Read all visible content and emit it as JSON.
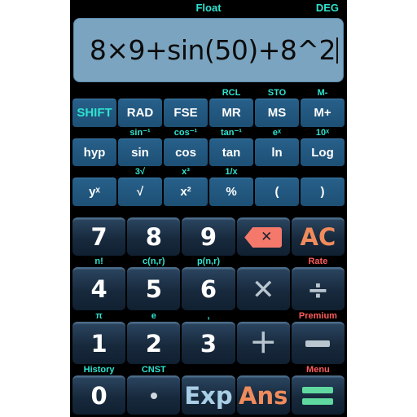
{
  "status": {
    "mode": "Float",
    "angle": "DEG"
  },
  "display": {
    "expression": "8×9+sin(50)+8^2"
  },
  "colors": {
    "cyan": "#2fe3d0",
    "red": "#ff5b5b",
    "orange": "#f08b5c",
    "green": "#5fd9a0",
    "display_bg": "#7ba4c0",
    "fn_button": "#20567e",
    "num_button": "#17293c"
  },
  "keypad": {
    "rows": [
      {
        "name": "row-shift",
        "keys": [
          {
            "sub": "",
            "label": "SHIFT",
            "icon": "",
            "style": "fn-cyan",
            "name": "shift"
          },
          {
            "sub": "",
            "label": "RAD",
            "icon": "",
            "style": "fn",
            "name": "rad"
          },
          {
            "sub": "",
            "label": "FSE",
            "icon": "",
            "style": "fn",
            "name": "fse"
          },
          {
            "sub": "RCL",
            "label": "MR",
            "icon": "",
            "style": "fn",
            "name": "memory-recall"
          },
          {
            "sub": "STO",
            "label": "MS",
            "icon": "",
            "style": "fn",
            "name": "memory-store"
          },
          {
            "sub": "M-",
            "label": "M+",
            "icon": "",
            "style": "fn",
            "name": "memory-add"
          }
        ]
      },
      {
        "name": "row-trig",
        "keys": [
          {
            "sub": "",
            "label": "hyp",
            "icon": "",
            "style": "fn",
            "name": "hyp"
          },
          {
            "sub": "sin⁻¹",
            "label": "sin",
            "icon": "",
            "style": "fn",
            "name": "sin"
          },
          {
            "sub": "cos⁻¹",
            "label": "cos",
            "icon": "",
            "style": "fn",
            "name": "cos"
          },
          {
            "sub": "tan⁻¹",
            "label": "tan",
            "icon": "",
            "style": "fn",
            "name": "tan"
          },
          {
            "sub": "eˣ",
            "label": "ln",
            "icon": "",
            "style": "fn",
            "name": "ln"
          },
          {
            "sub": "10ˣ",
            "label": "Log",
            "icon": "",
            "style": "fn",
            "name": "log"
          }
        ]
      },
      {
        "name": "row-power",
        "keys": [
          {
            "sub": "",
            "label": "yˣ",
            "icon": "",
            "style": "fn",
            "name": "y-to-x"
          },
          {
            "sub": "3√",
            "label": "√",
            "icon": "",
            "style": "fn",
            "name": "square-root"
          },
          {
            "sub": "x³",
            "label": "x²",
            "icon": "",
            "style": "fn",
            "name": "x-squared"
          },
          {
            "sub": "1/x",
            "label": "%",
            "icon": "",
            "style": "fn",
            "name": "percent"
          },
          {
            "sub": "",
            "label": "(",
            "icon": "",
            "style": "fn",
            "name": "open-paren"
          },
          {
            "sub": "",
            "label": ")",
            "icon": "",
            "style": "fn",
            "name": "close-paren"
          }
        ]
      },
      {
        "name": "row-789",
        "keys": [
          {
            "sub": "",
            "label": "7",
            "icon": "",
            "style": "num",
            "name": "digit-7"
          },
          {
            "sub": "",
            "label": "8",
            "icon": "",
            "style": "num",
            "name": "digit-8"
          },
          {
            "sub": "",
            "label": "9",
            "icon": "",
            "style": "num",
            "name": "digit-9"
          },
          {
            "sub": "",
            "label": "",
            "icon": "backspace",
            "style": "num",
            "name": "backspace"
          },
          {
            "sub": "",
            "label": "AC",
            "icon": "",
            "style": "num-orange",
            "name": "all-clear"
          }
        ]
      },
      {
        "name": "row-456",
        "keys": [
          {
            "sub": "n!",
            "label": "4",
            "icon": "",
            "style": "num",
            "name": "digit-4"
          },
          {
            "sub": "c(n,r)",
            "label": "5",
            "icon": "",
            "style": "num",
            "name": "digit-5"
          },
          {
            "sub": "p(n,r)",
            "label": "6",
            "icon": "",
            "style": "num",
            "name": "digit-6"
          },
          {
            "sub": "",
            "label": "",
            "icon": "multiply",
            "style": "num-op",
            "name": "multiply"
          },
          {
            "sub": "Rate",
            "subred": true,
            "label": "",
            "icon": "divide",
            "style": "num-op",
            "name": "divide"
          }
        ]
      },
      {
        "name": "row-123",
        "keys": [
          {
            "sub": "π",
            "label": "1",
            "icon": "",
            "style": "num",
            "name": "digit-1"
          },
          {
            "sub": "e",
            "label": "2",
            "icon": "",
            "style": "num",
            "name": "digit-2"
          },
          {
            "sub": ",",
            "label": "3",
            "icon": "",
            "style": "num",
            "name": "digit-3"
          },
          {
            "sub": "",
            "label": "",
            "icon": "plus",
            "style": "num-op",
            "name": "plus"
          },
          {
            "sub": "Premium",
            "subred": true,
            "label": "",
            "icon": "minus",
            "style": "num-op",
            "name": "minus"
          }
        ]
      },
      {
        "name": "row-bottom",
        "keys": [
          {
            "sub": "History",
            "label": "0",
            "icon": "",
            "style": "num",
            "name": "digit-0"
          },
          {
            "sub": "CNST",
            "label": "",
            "icon": "dot",
            "style": "num",
            "name": "decimal-point"
          },
          {
            "sub": "",
            "label": "Exp",
            "icon": "",
            "style": "num-blue",
            "name": "exponent"
          },
          {
            "sub": "",
            "label": "Ans",
            "icon": "",
            "style": "num-orange",
            "name": "answer"
          },
          {
            "sub": "Menu",
            "subred": true,
            "label": "",
            "icon": "equals",
            "style": "num",
            "name": "equals"
          }
        ]
      }
    ]
  }
}
